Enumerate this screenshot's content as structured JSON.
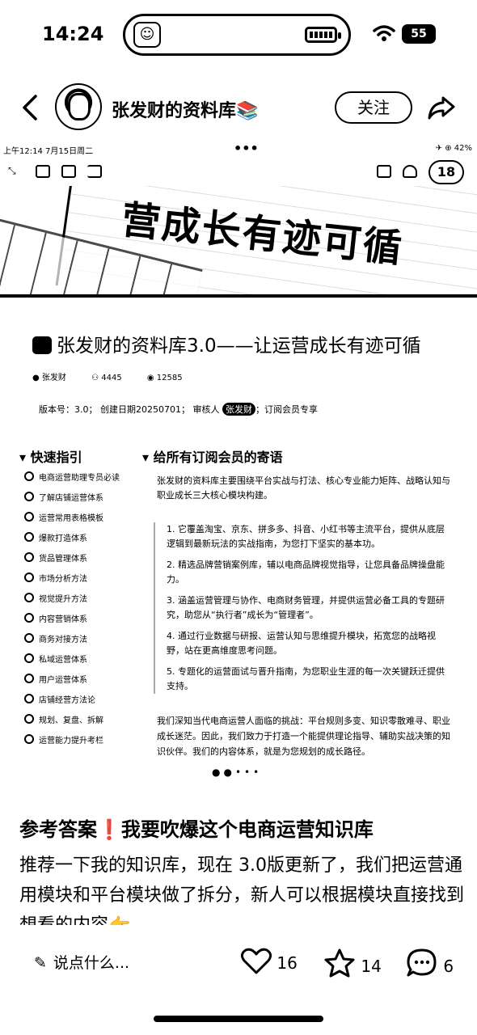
{
  "status_bar": {
    "time": "14:24",
    "battery": "55"
  },
  "nav": {
    "author_name": "张发财的资料库📚",
    "follow_label": "关注"
  },
  "post_image": {
    "inner_status": {
      "time": "上午12:14  7月15日周二",
      "dots": "•••",
      "right": "✈ ⊕ 42%"
    },
    "badge": "18",
    "banner_text": "营成长有迹可循",
    "doc_title": "张发财的资料库3.0——让运营成长有迹可循",
    "meta": {
      "author": "张发财",
      "readers": "4445",
      "views": "12585"
    },
    "info_line": {
      "prefix": "版本号：3.0；  创建日期20250701；  审核人 ",
      "pill": "张发财",
      "suffix": "；订阅会员专享"
    },
    "toc_heading": "▾ 快速指引",
    "toc_items": [
      "电商运营助理专员必读",
      "了解店铺运营体系",
      "运营常用表格模板",
      "爆款打造体系",
      "货品管理体系",
      "市场分析方法",
      "视觉提升方法",
      "内容营销体系",
      "商务对接方法",
      "私域运营体系",
      "用户运营体系",
      "店铺经营方法论",
      "规划、复盘、拆解",
      "运营能力提升考栏"
    ],
    "content_heading": "▾ 给所有订阅会员的寄语",
    "intro": "张发财的资料库主要围绕平台实战与打法、核心专业能力矩阵、战略认知与职业成长三大核心模块构建。",
    "list": [
      "1. 它覆盖淘宝、京东、拼多多、抖音、小红书等主流平台，提供从底层逻辑到最新玩法的实战指南，为您打下坚实的基本功。",
      "2. 精选品牌营销案例库，辅以电商品牌视觉指导，让您具备品牌操盘能力。",
      "3. 涵盖运营管理与协作、电商财务管理，并提供运营必备工具的专题研究，助您从“执行者”成长为“管理者”。",
      "4. 通过行业数据与研报、运营认知与思维提升模块，拓宽您的战略视野，站在更高维度思考问题。",
      "5. 专题化的运营面试与晋升指南，为您职业生涯的每一次关键跃迁提供支持。"
    ],
    "outro": "我们深知当代电商运营人面临的挑战：平台规则多变、知识零散难寻、职业成长迷茫。因此，我们致力于打造一个能提供理论指导、辅助实战决策的知识伙伴。我们的内容体系，就是为您规划的成长路径。",
    "pager": "●●•••"
  },
  "post": {
    "title": "参考答案❗我要吹爆这个电商运营知识库",
    "body": "推荐一下我的知识库，现在 3.0版更新了，我们把运营通用模块和平台模块做了拆分，新人可以根据模块直接找到想看的内容👉"
  },
  "bottom_bar": {
    "comment_placeholder": "说点什么...",
    "likes": "16",
    "stars": "14",
    "comments": "6"
  }
}
